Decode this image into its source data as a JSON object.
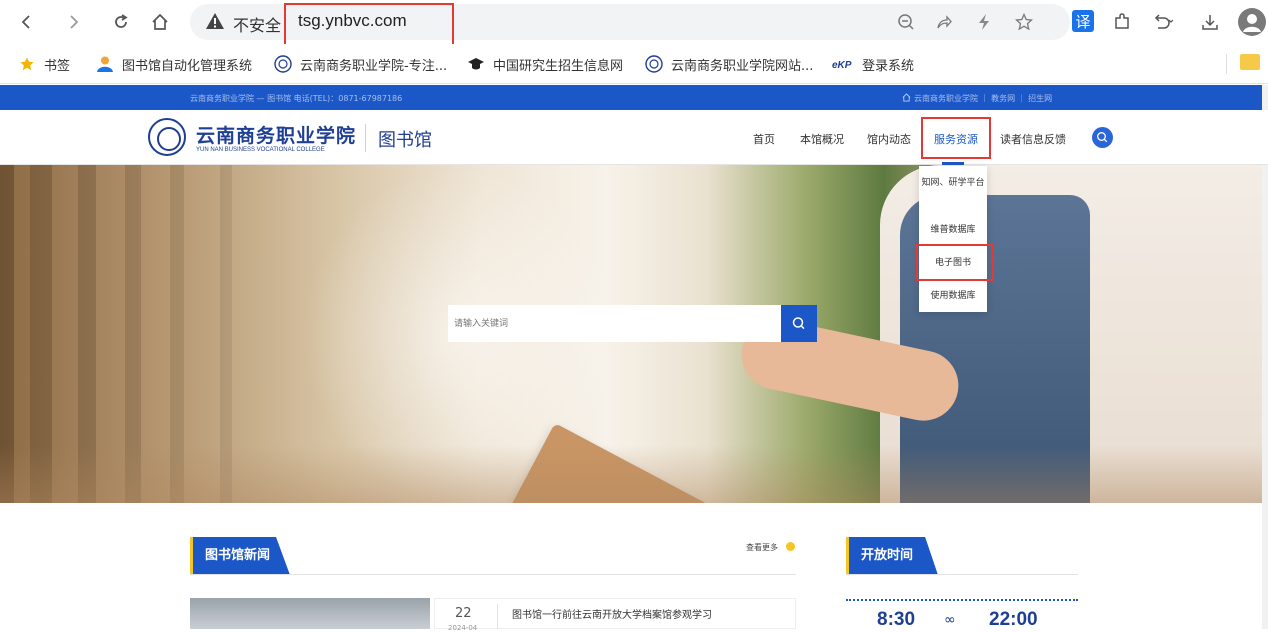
{
  "browser": {
    "insecure_label": "不安全",
    "url": "tsg.ynbvc.com",
    "translate_label": "译"
  },
  "bookmarks": [
    {
      "label": "书签",
      "icon": "star-icon"
    },
    {
      "label": "图书馆自动化管理系统",
      "icon": "user-icon"
    },
    {
      "label": "云南商务职业学院-专注...",
      "icon": "college-seal-icon"
    },
    {
      "label": "中国研究生招生信息网",
      "icon": "graduation-cap-icon"
    },
    {
      "label": "云南商务职业学院网站...",
      "icon": "college-seal-icon"
    },
    {
      "label": "登录系统",
      "icon": "ekp-icon"
    }
  ],
  "site": {
    "topbar_left": "云南商务职业学院 — 图书馆 电话(TEL)：0871-67987186",
    "topbar_right": "云南商务职业学院 ｜ 教务网 ｜ 招生网",
    "logo_cn": "云南商务职业学院",
    "logo_en": "YUN NAN BUSINESS VOCATIONAL COLLEGE",
    "logo_library": "图书馆",
    "nav": [
      "首页",
      "本馆概况",
      "馆内动态",
      "服务资源",
      "读者信息反馈"
    ],
    "active_nav": "服务资源",
    "dropdown": [
      "知网、研学平台",
      "维普数据库",
      "电子图书",
      "使用数据库"
    ],
    "highlighted_dropdown": "电子图书",
    "search_placeholder": "请输入关键词",
    "news_title": "图书馆新闻",
    "more_label": "查看更多",
    "open_title": "开放时间",
    "open_from": "8:30",
    "open_symbol": "∞",
    "open_to": "22:00",
    "news_item": {
      "day": "22",
      "year_month": "2024-04",
      "title": "图书馆一行前往云南开放大学档案馆参观学习"
    }
  },
  "colors": {
    "site_blue": "#1c57c8",
    "accent_yellow": "#f3c623",
    "highlight_red": "#e53935"
  }
}
